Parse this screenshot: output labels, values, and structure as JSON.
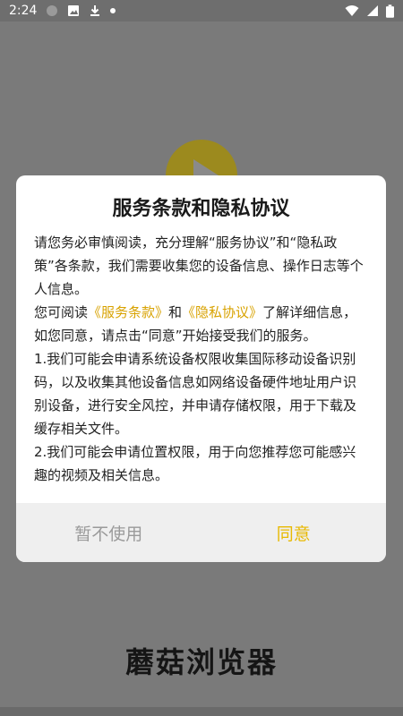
{
  "status_bar": {
    "time": "2:24"
  },
  "app": {
    "name": "蘑菇浏览器"
  },
  "dialog": {
    "title": "服务条款和隐私协议",
    "para1": "请您务必审慎阅读，充分理解“服务协议”和“隐私政策”各条款，我们需要收集您的设备信息、操作日志等个人信息。",
    "para2_prefix": "您可阅读",
    "link_terms": "《服务条款》",
    "para2_and": "和",
    "link_privacy": "《隐私协议》",
    "para2_suffix": "了解详细信息，如您同意，请点击“同意”开始接受我们的服务。",
    "item1": "1.我们可能会申请系统设备权限收集国际移动设备识别码，以及收集其他设备信息如网络设备硬件地址用户识别设备，进行安全风控，并申请存储权限，用于下载及缓存相关文件。",
    "item2": "2.我们可能会申请位置权限，用于向您推荐您可能感兴趣的视频及相关信息。",
    "cancel_label": "暂不使用",
    "agree_label": "同意"
  },
  "colors": {
    "accent": "#e8b900",
    "link": "#d8a200",
    "overlay": "#7a7a7a"
  }
}
